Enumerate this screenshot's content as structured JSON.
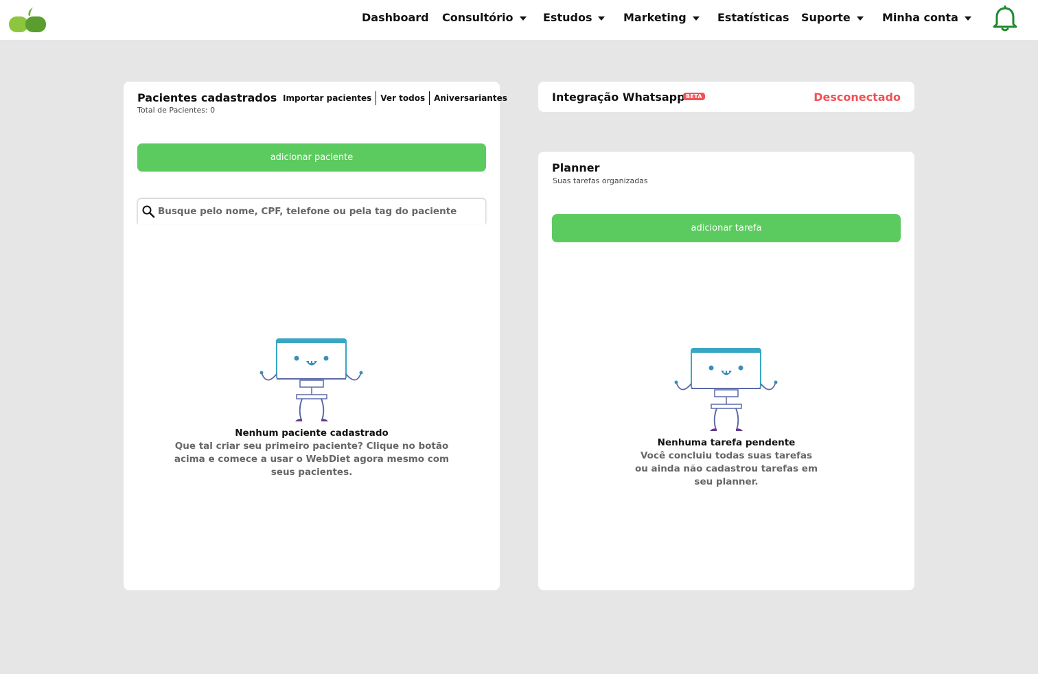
{
  "header": {
    "nav": [
      {
        "label": "Dashboard",
        "dropdown": false
      },
      {
        "label": "Consultório",
        "dropdown": true
      },
      {
        "label": "Estudos",
        "dropdown": true
      },
      {
        "label": "Marketing",
        "dropdown": true
      },
      {
        "label": "Estatísticas",
        "dropdown": false
      },
      {
        "label": "Suporte",
        "dropdown": true
      },
      {
        "label": "Minha conta",
        "dropdown": true
      }
    ],
    "logo_icon": "apple-logo-icon",
    "bell_icon": "bell-icon",
    "colors": {
      "logo_light": "#8cc63f",
      "logo_dark": "#5a9e2f",
      "bell": "#1e8a2e"
    }
  },
  "patients": {
    "title": "Pacientes cadastrados",
    "subtitle": "Total de Pacientes: 0",
    "links": [
      "Importar pacientes",
      "Ver todos",
      "Aniversariantes"
    ],
    "add_button": "adicionar paciente",
    "search_placeholder": "Busque pelo nome, CPF, telefone ou pela tag do paciente",
    "empty_title": "Nenhum paciente cadastrado",
    "empty_lines": [
      "Que tal criar seu primeiro paciente? Clique no botão",
      "acima e comece a usar o WebDiet agora mesmo com",
      "seus pacientes."
    ]
  },
  "whatsapp": {
    "title": "Integração Whatsapp",
    "badge": "BETA",
    "status": "Desconectado"
  },
  "planner": {
    "title": "Planner",
    "subtitle": "Suas tarefas organizadas",
    "add_button": "adicionar tarefa",
    "empty_title": "Nenhuma tarefa pendente",
    "empty_lines": [
      "Você concluiu todas suas tarefas",
      "ou ainda não cadastrou tarefas em",
      "seu planner."
    ]
  },
  "colors": {
    "accent_green": "#5ccb5f",
    "danger": "#f25055",
    "background": "#e6e6e6"
  }
}
